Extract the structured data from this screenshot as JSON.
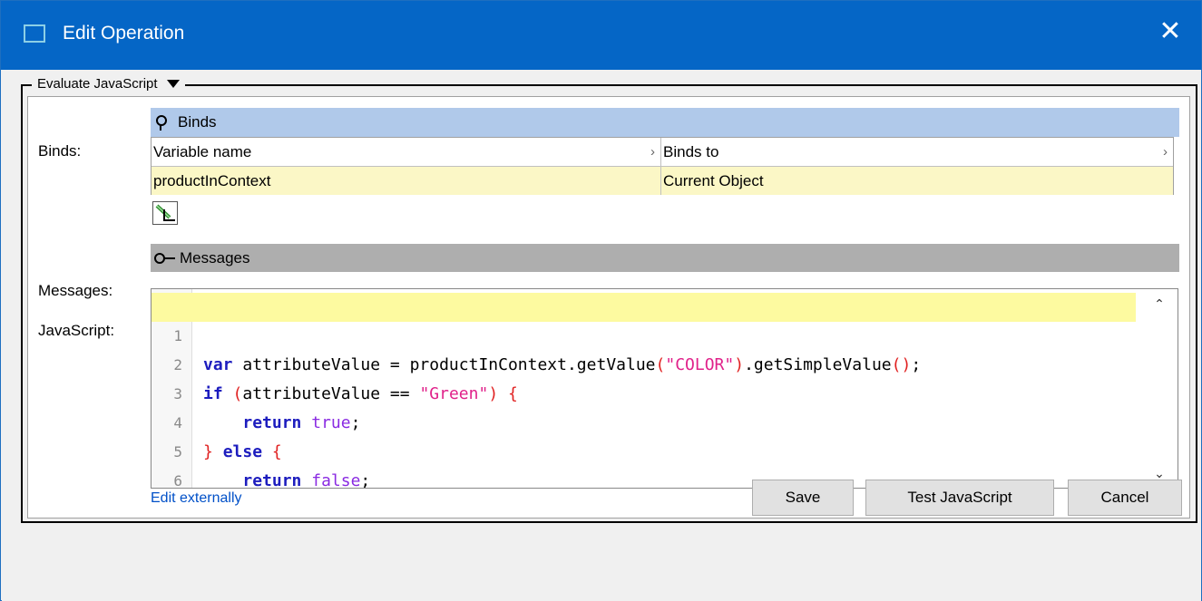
{
  "window": {
    "title": "Edit Operation"
  },
  "group": {
    "label": "Evaluate JavaScript"
  },
  "labels": {
    "binds": "Binds:",
    "messages": "Messages:",
    "javascript": "JavaScript:"
  },
  "binds": {
    "header": "Binds",
    "columns": [
      "Variable name",
      "Binds to"
    ],
    "rows": [
      {
        "variable": "productInContext",
        "binds_to": "Current Object"
      }
    ]
  },
  "messages": {
    "header": "Messages"
  },
  "code": {
    "line_numbers": [
      "1",
      "2",
      "3",
      "4",
      "5",
      "6"
    ],
    "lines": [
      "var attributeValue = productInContext.getValue(\"COLOR\").getSimpleValue();",
      "if (attributeValue == \"Green\") {",
      "    return true;",
      "} else {",
      "    return false;",
      "}"
    ]
  },
  "edit_externally": "Edit externally",
  "buttons": {
    "save": "Save",
    "test": "Test JavaScript",
    "cancel": "Cancel"
  }
}
